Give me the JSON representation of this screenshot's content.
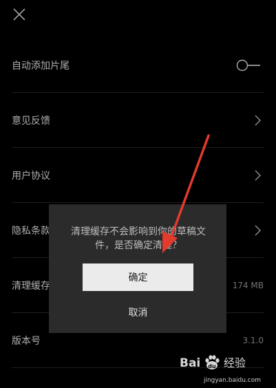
{
  "header": {
    "close_icon": "close-icon"
  },
  "settings": {
    "items": [
      {
        "label": "自动添加片尾",
        "control": "toggle",
        "toggle_on": false
      },
      {
        "label": "意见反馈",
        "control": "chevron"
      },
      {
        "label": "用户协议",
        "control": "chevron"
      },
      {
        "label": "隐私条款",
        "control": "chevron"
      },
      {
        "label": "清理缓存",
        "control": "value",
        "value": "174 MB"
      },
      {
        "label": "版本号",
        "control": "value",
        "value": "3.1.0"
      }
    ]
  },
  "dialog": {
    "message": "清理缓存不会影响到你的草稿文件，是否确定清理？",
    "confirm_label": "确定",
    "cancel_label": "取消"
  },
  "annotation": {
    "color": "#e23b2e"
  },
  "watermark": {
    "logo_text": "Baidu 经验",
    "url": "jingyan.baidu.com"
  },
  "colors": {
    "background": "#000000",
    "dialog_bg": "#2b2b2b",
    "confirm_bg": "#ebebeb"
  }
}
